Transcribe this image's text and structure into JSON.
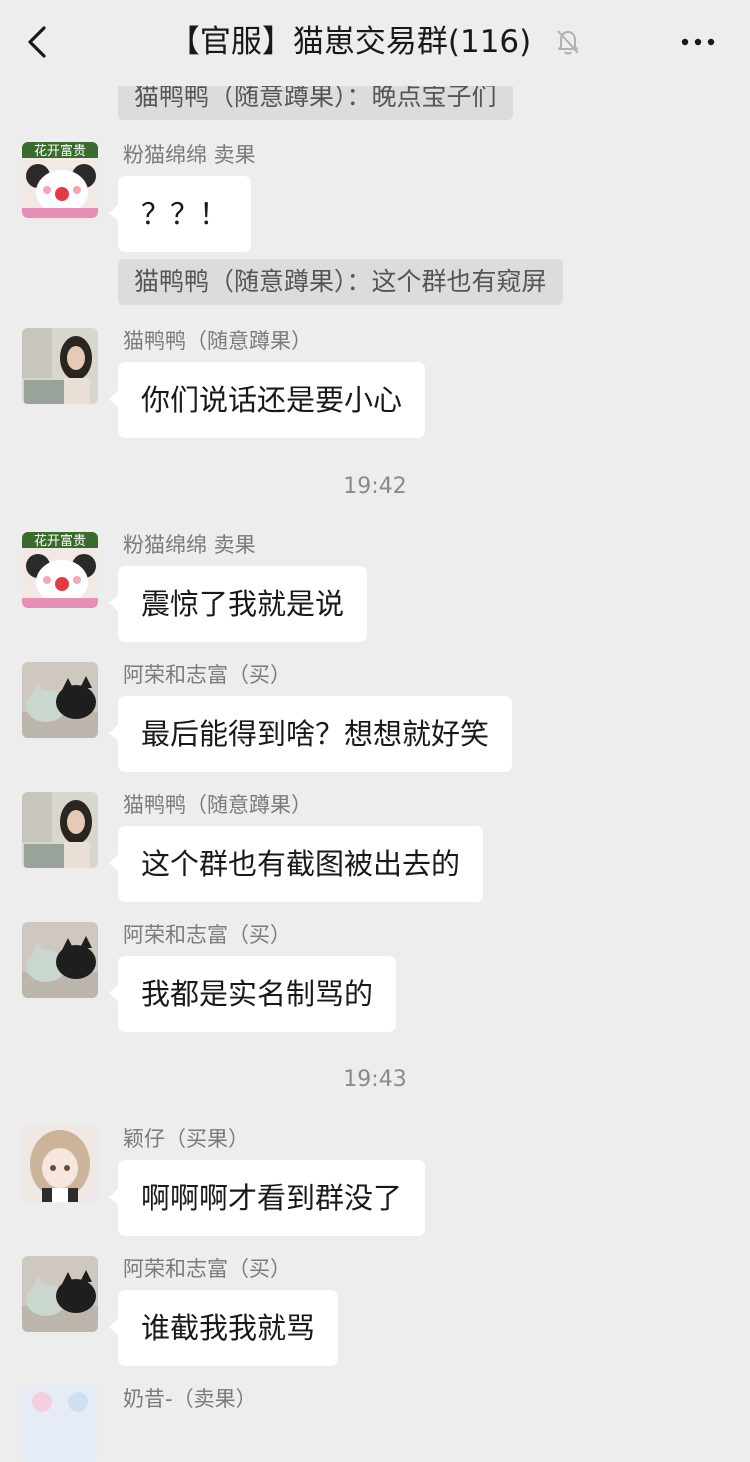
{
  "header": {
    "title": "【官服】猫崽交易群(116)"
  },
  "system_lines": [
    {
      "text": "猫鸭鸭（随意蹲果）：晚点宝子们"
    },
    {
      "text": "猫鸭鸭（随意蹲果）：这个群也有窥屏"
    }
  ],
  "messages": [
    {
      "sender": "粉猫绵绵  卖果",
      "text": "？？！",
      "avatar": "flower-cartoon",
      "avatar_text": "花开富贵"
    },
    {
      "sender": "猫鸭鸭（随意蹲果）",
      "text": "你们说话还是要小心",
      "avatar": "girl-photo"
    },
    {
      "sender": "粉猫绵绵  卖果",
      "text": "震惊了我就是说",
      "avatar": "flower-cartoon",
      "avatar_text": "花开富贵"
    },
    {
      "sender": "阿荣和志富（买）",
      "text": "最后能得到啥？想想就好笑",
      "avatar": "cats-photo"
    },
    {
      "sender": "猫鸭鸭（随意蹲果）",
      "text": "这个群也有截图被出去的",
      "avatar": "girl-photo"
    },
    {
      "sender": "阿荣和志富（买）",
      "text": "我都是实名制骂的",
      "avatar": "cats-photo"
    },
    {
      "sender": "颖仔（买果）",
      "text": "啊啊啊才看到群没了",
      "avatar": "anime-girl"
    },
    {
      "sender": "阿荣和志富（买）",
      "text": "谁截我我就骂",
      "avatar": "cats-photo"
    },
    {
      "sender": "奶昔-（卖果）",
      "text": "",
      "avatar": "pastel-avatar"
    }
  ],
  "timestamps": [
    "19:42",
    "19:43"
  ],
  "colors": {
    "background": "#ededed",
    "bubble": "#ffffff",
    "system_bg": "#dcdcdc",
    "name_text": "#7b7b7b"
  },
  "icons": [
    "back-arrow-icon",
    "mute-bell-icon",
    "more-dots-icon"
  ]
}
